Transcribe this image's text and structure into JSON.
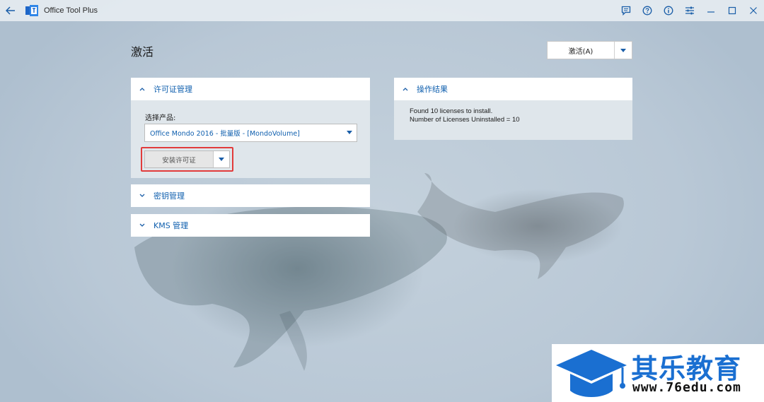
{
  "window": {
    "title": "Office Tool Plus"
  },
  "page": {
    "title": "激活",
    "activate_button": "激活(A)"
  },
  "license_panel": {
    "header": "许可证管理",
    "select_label": "选择产品:",
    "selected_product": "Office Mondo 2016 - 批量版 - [MondoVolume]",
    "install_button": "安装许可证"
  },
  "key_panel": {
    "header": "密钥管理"
  },
  "kms_panel": {
    "header": "KMS 管理"
  },
  "result_panel": {
    "header": "操作结果",
    "lines": [
      "Found 10 licenses to install.",
      "Number of Licenses Uninstalled = 10"
    ]
  },
  "watermark": {
    "text": "其乐教育",
    "url": "www.76edu.com"
  },
  "colors": {
    "accent": "#0f5fae",
    "highlight_border": "#e23b3b",
    "watermark_blue": "#1a6fd1"
  },
  "icons": {
    "back": "back-arrow-icon",
    "logo": "office-tool-plus-logo",
    "feedback": "feedback-icon",
    "help": "help-icon",
    "info": "info-icon",
    "settings": "settings-sliders-icon",
    "minimize": "minimize-icon",
    "maximize": "maximize-icon",
    "close": "close-icon"
  }
}
